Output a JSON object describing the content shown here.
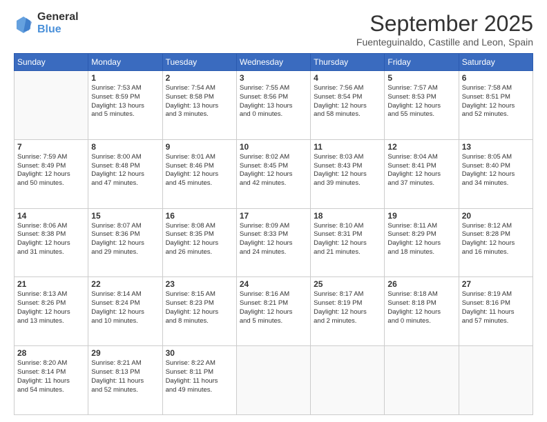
{
  "logo": {
    "general": "General",
    "blue": "Blue"
  },
  "header": {
    "month": "September 2025",
    "location": "Fuenteguinaldo, Castille and Leon, Spain"
  },
  "weekdays": [
    "Sunday",
    "Monday",
    "Tuesday",
    "Wednesday",
    "Thursday",
    "Friday",
    "Saturday"
  ],
  "weeks": [
    [
      {
        "day": "",
        "info": ""
      },
      {
        "day": "1",
        "info": "Sunrise: 7:53 AM\nSunset: 8:59 PM\nDaylight: 13 hours\nand 5 minutes."
      },
      {
        "day": "2",
        "info": "Sunrise: 7:54 AM\nSunset: 8:58 PM\nDaylight: 13 hours\nand 3 minutes."
      },
      {
        "day": "3",
        "info": "Sunrise: 7:55 AM\nSunset: 8:56 PM\nDaylight: 13 hours\nand 0 minutes."
      },
      {
        "day": "4",
        "info": "Sunrise: 7:56 AM\nSunset: 8:54 PM\nDaylight: 12 hours\nand 58 minutes."
      },
      {
        "day": "5",
        "info": "Sunrise: 7:57 AM\nSunset: 8:53 PM\nDaylight: 12 hours\nand 55 minutes."
      },
      {
        "day": "6",
        "info": "Sunrise: 7:58 AM\nSunset: 8:51 PM\nDaylight: 12 hours\nand 52 minutes."
      }
    ],
    [
      {
        "day": "7",
        "info": "Sunrise: 7:59 AM\nSunset: 8:49 PM\nDaylight: 12 hours\nand 50 minutes."
      },
      {
        "day": "8",
        "info": "Sunrise: 8:00 AM\nSunset: 8:48 PM\nDaylight: 12 hours\nand 47 minutes."
      },
      {
        "day": "9",
        "info": "Sunrise: 8:01 AM\nSunset: 8:46 PM\nDaylight: 12 hours\nand 45 minutes."
      },
      {
        "day": "10",
        "info": "Sunrise: 8:02 AM\nSunset: 8:45 PM\nDaylight: 12 hours\nand 42 minutes."
      },
      {
        "day": "11",
        "info": "Sunrise: 8:03 AM\nSunset: 8:43 PM\nDaylight: 12 hours\nand 39 minutes."
      },
      {
        "day": "12",
        "info": "Sunrise: 8:04 AM\nSunset: 8:41 PM\nDaylight: 12 hours\nand 37 minutes."
      },
      {
        "day": "13",
        "info": "Sunrise: 8:05 AM\nSunset: 8:40 PM\nDaylight: 12 hours\nand 34 minutes."
      }
    ],
    [
      {
        "day": "14",
        "info": "Sunrise: 8:06 AM\nSunset: 8:38 PM\nDaylight: 12 hours\nand 31 minutes."
      },
      {
        "day": "15",
        "info": "Sunrise: 8:07 AM\nSunset: 8:36 PM\nDaylight: 12 hours\nand 29 minutes."
      },
      {
        "day": "16",
        "info": "Sunrise: 8:08 AM\nSunset: 8:35 PM\nDaylight: 12 hours\nand 26 minutes."
      },
      {
        "day": "17",
        "info": "Sunrise: 8:09 AM\nSunset: 8:33 PM\nDaylight: 12 hours\nand 24 minutes."
      },
      {
        "day": "18",
        "info": "Sunrise: 8:10 AM\nSunset: 8:31 PM\nDaylight: 12 hours\nand 21 minutes."
      },
      {
        "day": "19",
        "info": "Sunrise: 8:11 AM\nSunset: 8:29 PM\nDaylight: 12 hours\nand 18 minutes."
      },
      {
        "day": "20",
        "info": "Sunrise: 8:12 AM\nSunset: 8:28 PM\nDaylight: 12 hours\nand 16 minutes."
      }
    ],
    [
      {
        "day": "21",
        "info": "Sunrise: 8:13 AM\nSunset: 8:26 PM\nDaylight: 12 hours\nand 13 minutes."
      },
      {
        "day": "22",
        "info": "Sunrise: 8:14 AM\nSunset: 8:24 PM\nDaylight: 12 hours\nand 10 minutes."
      },
      {
        "day": "23",
        "info": "Sunrise: 8:15 AM\nSunset: 8:23 PM\nDaylight: 12 hours\nand 8 minutes."
      },
      {
        "day": "24",
        "info": "Sunrise: 8:16 AM\nSunset: 8:21 PM\nDaylight: 12 hours\nand 5 minutes."
      },
      {
        "day": "25",
        "info": "Sunrise: 8:17 AM\nSunset: 8:19 PM\nDaylight: 12 hours\nand 2 minutes."
      },
      {
        "day": "26",
        "info": "Sunrise: 8:18 AM\nSunset: 8:18 PM\nDaylight: 12 hours\nand 0 minutes."
      },
      {
        "day": "27",
        "info": "Sunrise: 8:19 AM\nSunset: 8:16 PM\nDaylight: 11 hours\nand 57 minutes."
      }
    ],
    [
      {
        "day": "28",
        "info": "Sunrise: 8:20 AM\nSunset: 8:14 PM\nDaylight: 11 hours\nand 54 minutes."
      },
      {
        "day": "29",
        "info": "Sunrise: 8:21 AM\nSunset: 8:13 PM\nDaylight: 11 hours\nand 52 minutes."
      },
      {
        "day": "30",
        "info": "Sunrise: 8:22 AM\nSunset: 8:11 PM\nDaylight: 11 hours\nand 49 minutes."
      },
      {
        "day": "",
        "info": ""
      },
      {
        "day": "",
        "info": ""
      },
      {
        "day": "",
        "info": ""
      },
      {
        "day": "",
        "info": ""
      }
    ]
  ]
}
